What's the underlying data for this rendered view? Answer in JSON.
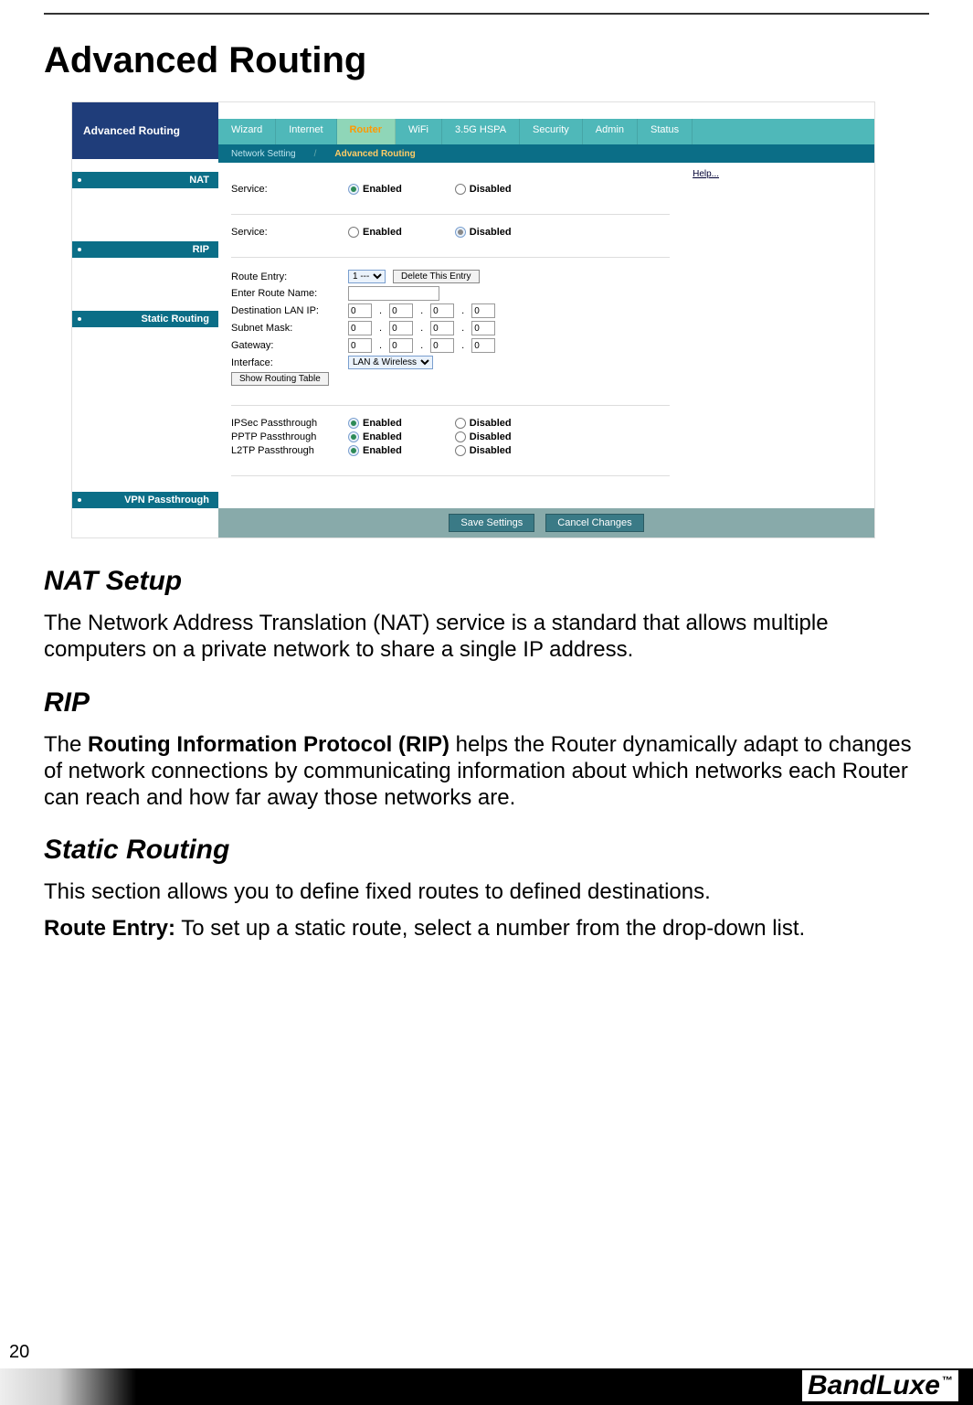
{
  "doc": {
    "title": "Advanced Routing",
    "nat_h": "NAT Setup",
    "nat_p": "The Network Address Translation (NAT) service is a standard that allows multiple computers on a private network to share a single IP address.",
    "rip_h": "RIP",
    "rip_p_pre": "The ",
    "rip_p_b": "Routing Information Protocol (RIP)",
    "rip_p_post": " helps the Router dynamically adapt to changes of network connections by communicating information about which networks each Router can reach and how far away those networks are.",
    "sr_h": "Static Routing",
    "sr_p1": "This section allows you to define fixed routes to defined destinations.",
    "sr_p2_b": "Route Entry:",
    "sr_p2": " To set up a static route, select a number from the drop-down list.",
    "page_number": "20",
    "brand": "BandLuxe",
    "brand_tm": "™"
  },
  "ui": {
    "panel_title": "Advanced Routing",
    "tabs": [
      "Wizard",
      "Internet",
      "Router",
      "WiFi",
      "3.5G HSPA",
      "Security",
      "Admin",
      "Status"
    ],
    "active_tab": "Router",
    "subtabs": [
      "Network Setting",
      "Advanced Routing"
    ],
    "active_subtab": "Advanced Routing",
    "help": "Help...",
    "side": {
      "nat": "NAT",
      "rip": "RIP",
      "static": "Static Routing",
      "vpn": "VPN Passthrough"
    },
    "labels": {
      "service": "Service:",
      "enabled": "Enabled",
      "disabled": "Disabled",
      "route_entry": "Route Entry:",
      "enter_route_name": "Enter Route Name:",
      "dest_lan_ip": "Destination LAN IP:",
      "subnet_mask": "Subnet Mask:",
      "gateway": "Gateway:",
      "interface": "Interface:",
      "show_routing_table": "Show Routing Table",
      "delete_entry": "Delete This Entry",
      "ipsec": "IPSec Passthrough",
      "pptp": "PPTP Passthrough",
      "l2tp": "L2TP Passthrough",
      "save": "Save Settings",
      "cancel": "Cancel Changes"
    },
    "values": {
      "nat_service": "Enabled",
      "rip_service": "Disabled",
      "route_entry_sel": "1 ---",
      "route_name": "",
      "dest_ip": [
        "0",
        "0",
        "0",
        "0"
      ],
      "subnet": [
        "0",
        "0",
        "0",
        "0"
      ],
      "gateway": [
        "0",
        "0",
        "0",
        "0"
      ],
      "interface_sel": "LAN & Wireless",
      "ipsec": "Enabled",
      "pptp": "Enabled",
      "l2tp": "Enabled"
    }
  }
}
